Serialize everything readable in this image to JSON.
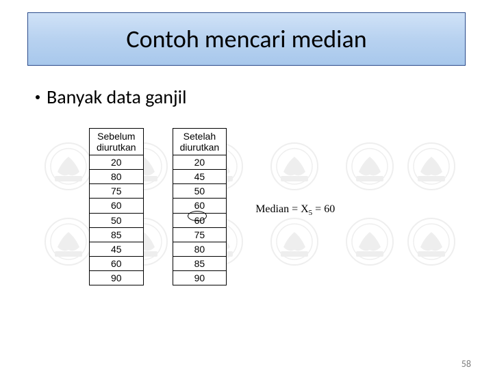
{
  "title": "Contoh mencari median",
  "bullet": "Banyak data ganjil",
  "tables": {
    "before": {
      "header_line1": "Sebelum",
      "header_line2": "diurutkan",
      "values": [
        "20",
        "80",
        "75",
        "60",
        "50",
        "85",
        "45",
        "60",
        "90"
      ]
    },
    "after": {
      "header_line1": "Setelah",
      "header_line2": "diurutkan",
      "values": [
        "20",
        "45",
        "50",
        "60",
        "60",
        "75",
        "80",
        "85",
        "90"
      ]
    }
  },
  "median": {
    "label": "Median",
    "subscript_var": "X",
    "subscript_num": "5",
    "value": "60"
  },
  "page_number": "58"
}
